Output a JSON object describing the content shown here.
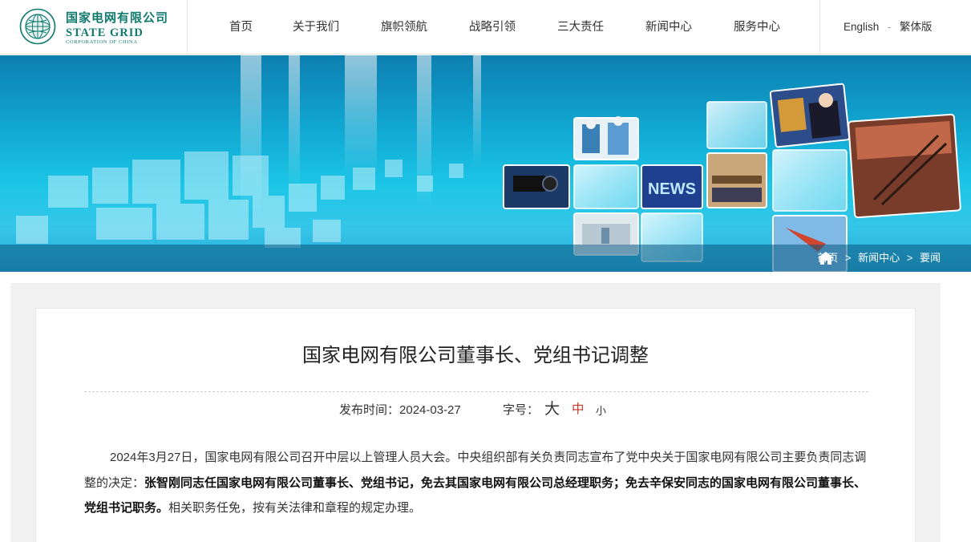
{
  "header": {
    "logo": {
      "name_cn": "国家电网有限公司",
      "name_en": "STATE GRID",
      "name_en_sub": "CORPORATION OF CHINA"
    },
    "nav": [
      "首页",
      "关于我们",
      "旗帜领航",
      "战略引领",
      "三大责任",
      "新闻中心",
      "服务中心"
    ],
    "lang": {
      "english": "English",
      "separator": "-",
      "traditional": "繁体版"
    }
  },
  "banner": {
    "news_tile_text": "NEWS",
    "breadcrumb": [
      "首页",
      "新闻中心",
      "要闻"
    ],
    "breadcrumb_sep": ">"
  },
  "article": {
    "title": "国家电网有限公司董事长、党组书记调整",
    "publish_label": "发布时间：",
    "publish_date": "2024-03-27",
    "font_label": "字号：",
    "font_sizes": [
      "大",
      "中",
      "小"
    ],
    "paragraph": {
      "lead": "2024年3月27日，国家电网有限公司召开中层以上管理人员大会。中央组织部有关负责同志宣布了党中央关于国家电网有限公司主要负责同志调整的决定：",
      "bold": "张智刚同志任国家电网有限公司董事长、党组书记，免去其国家电网有限公司总经理职务；免去辛保安同志的国家电网有限公司董事长、党组书记职务。",
      "tail": "相关职务任免，按有关法律和章程的规定办理。"
    }
  },
  "colors": {
    "brand_green": "#0f7b6e",
    "font_large": "#333333",
    "font_medium": "#c0392b",
    "font_small": "#333333",
    "banner_blue": "#11a9d3"
  }
}
